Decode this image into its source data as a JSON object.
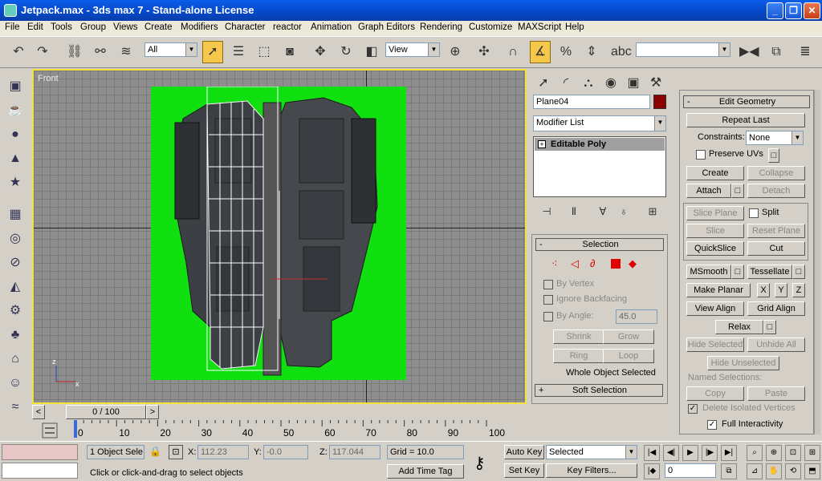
{
  "window": {
    "title": "Jetpack.max - 3ds max 7 - Stand-alone License"
  },
  "menu": [
    "File",
    "Edit",
    "Tools",
    "Group",
    "Views",
    "Create",
    "Modifiers",
    "Character",
    "reactor",
    "Animation",
    "Graph Editors",
    "Rendering",
    "Customize",
    "MAXScript",
    "Help"
  ],
  "toolbar": {
    "selection_filter": "All",
    "reference_coord": "View",
    "named_selection": ""
  },
  "viewport": {
    "label": "Front"
  },
  "timeline": {
    "frame_display": "0 / 100",
    "ruler_ticks": [
      "0",
      "10",
      "20",
      "30",
      "40",
      "50",
      "60",
      "70",
      "80",
      "90",
      "100"
    ]
  },
  "command_panel": {
    "object_name": "Plane04",
    "object_color": "#8b0000",
    "modifier_list": "Modifier List",
    "stack_item": "Editable Poly",
    "selection": {
      "header": "Selection",
      "by_vertex": "By Vertex",
      "ignore_backfacing": "Ignore Backfacing",
      "by_angle": "By Angle:",
      "angle_value": "45.0",
      "shrink": "Shrink",
      "grow": "Grow",
      "ring": "Ring",
      "loop": "Loop",
      "status": "Whole Object Selected"
    },
    "soft_selection": "Soft Selection"
  },
  "edit_geometry": {
    "header": "Edit Geometry",
    "repeat_last": "Repeat Last",
    "constraints_label": "Constraints:",
    "constraints_value": "None",
    "preserve_uvs": "Preserve UVs",
    "create": "Create",
    "collapse": "Collapse",
    "attach": "Attach",
    "detach": "Detach",
    "slice_plane": "Slice Plane",
    "split": "Split",
    "slice": "Slice",
    "reset_plane": "Reset Plane",
    "quickslice": "QuickSlice",
    "cut": "Cut",
    "msmooth": "MSmooth",
    "tessellate": "Tessellate",
    "make_planar": "Make Planar",
    "x": "X",
    "y": "Y",
    "z": "Z",
    "view_align": "View Align",
    "grid_align": "Grid Align",
    "relax": "Relax",
    "hide_selected": "Hide Selected",
    "unhide_all": "Unhide All",
    "hide_unselected": "Hide Unselected",
    "named_selections": "Named Selections:",
    "copy": "Copy",
    "paste": "Paste",
    "delete_isolated": "Delete Isolated Vertices",
    "full_interactivity": "Full Interactivity"
  },
  "status": {
    "selection_count": "1 Object Sele",
    "x_label": "X:",
    "x_value": "112.23",
    "y_label": "Y:",
    "y_value": "-0.0",
    "z_label": "Z:",
    "z_value": "117.044",
    "grid": "Grid = 10.0",
    "prompt": "Click or click-and-drag to select objects",
    "add_time_tag": "Add Time Tag",
    "auto_key": "Auto Key",
    "set_key": "Set Key",
    "key_mode": "Selected",
    "key_filters": "Key Filters...",
    "current_frame": "0"
  },
  "colors": {
    "accent": "#f5c74a",
    "plane": "#10e010",
    "viewport_border": "#f2e23a"
  }
}
